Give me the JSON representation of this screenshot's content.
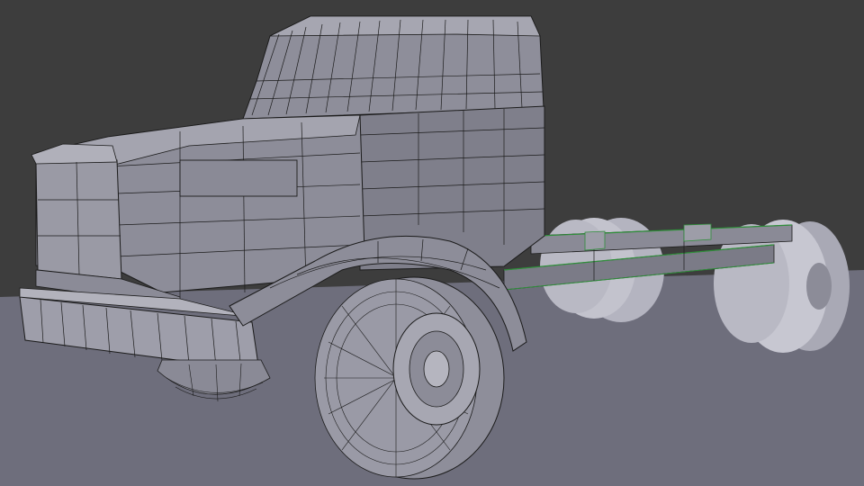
{
  "scene": {
    "subject": "truck-chassis-wireframe-model",
    "colors": {
      "background": "#3d3d3d",
      "floor": "#6e6e7c",
      "body": "#8f8f9c",
      "body_light": "#a9a9b4",
      "body_dark": "#6a6a76",
      "wire": "#1b1b1b",
      "selected_edge": "#2f8f3a",
      "wheel_far": "#b9b9c4"
    }
  }
}
